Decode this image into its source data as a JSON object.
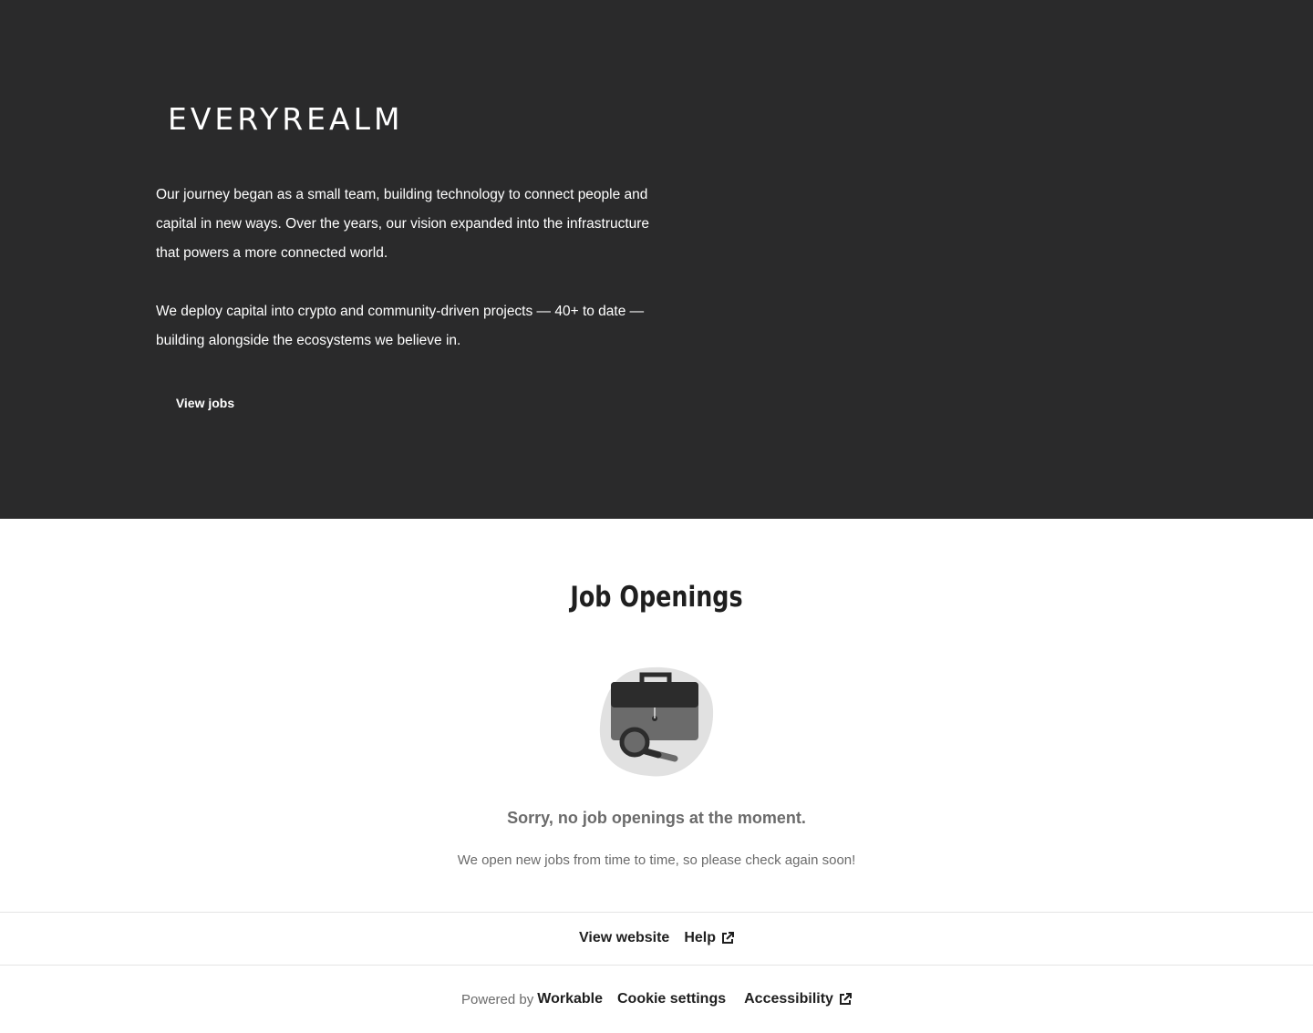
{
  "hero": {
    "logo_text": "EVERYREALM",
    "paragraph_1": "Our journey began as a small team, building technology to connect people and capital in new ways. Over the years, our vision expanded into the infrastructure that powers a more connected world.",
    "paragraph_2": "We deploy capital into crypto and community-driven projects — 40+ to date — building alongside the ecosystems we believe in.",
    "view_jobs_label": "View jobs",
    "background_color": "#2a2a2b"
  },
  "openings": {
    "title": "Job Openings",
    "empty_icon": "briefcase-search-icon",
    "empty_title": "Sorry, no job openings at the moment.",
    "empty_subtitle": "We open new jobs from time to time, so please check again soon!"
  },
  "footer": {
    "view_website_label": "View website",
    "help_label": "Help",
    "powered_by_label": "Powered by",
    "workable_label": "Workable",
    "cookie_settings_label": "Cookie settings",
    "accessibility_label": "Accessibility",
    "external_link_icon": "external-link-icon"
  }
}
